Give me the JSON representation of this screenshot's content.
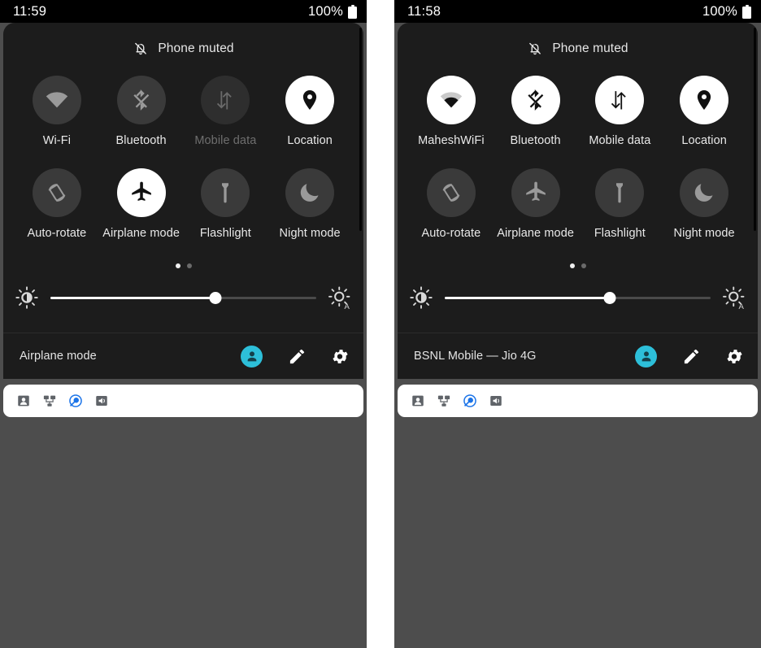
{
  "panels": [
    {
      "name": "left-panel",
      "status_bar": {
        "clock": "11:59",
        "battery_text": "100%",
        "battery_icon": "battery-full-icon"
      },
      "header": {
        "icon": "bell-muted-icon",
        "label": "Phone muted"
      },
      "tiles_row1": [
        {
          "label": "Wi-Fi",
          "icon": "wifi-icon",
          "state": "off"
        },
        {
          "label": "Bluetooth",
          "icon": "bluetooth-icon",
          "state": "off"
        },
        {
          "label": "Mobile data",
          "icon": "mobile-data-icon",
          "state": "disabled"
        },
        {
          "label": "Location",
          "icon": "location-pin-icon",
          "state": "on"
        }
      ],
      "tiles_row2": [
        {
          "label": "Auto-rotate",
          "icon": "auto-rotate-icon",
          "state": "off"
        },
        {
          "label": "Airplane mode",
          "icon": "airplane-icon",
          "state": "on"
        },
        {
          "label": "Flashlight",
          "icon": "flashlight-icon",
          "state": "off"
        },
        {
          "label": "Night mode",
          "icon": "moon-icon",
          "state": "off"
        }
      ],
      "pager": {
        "count": 2,
        "active_index": 0
      },
      "brightness": {
        "low_icon": "brightness-low-icon",
        "auto_icon": "brightness-auto-icon",
        "value_percent": 62
      },
      "footer": {
        "status_text": "Airplane mode",
        "avatar_icon": "user-avatar-icon",
        "edit_icon": "pencil-icon",
        "settings_icon": "gear-icon"
      },
      "notification_icons": [
        {
          "icon": "contact-card-icon",
          "color": "#5f6368"
        },
        {
          "icon": "network-devices-icon",
          "color": "#5f6368"
        },
        {
          "icon": "nearby-share-icon",
          "color": "#1a73e8"
        },
        {
          "icon": "sound-volume-icon",
          "color": "#5f6368"
        }
      ]
    },
    {
      "name": "right-panel",
      "status_bar": {
        "clock": "11:58",
        "battery_text": "100%",
        "battery_icon": "battery-full-icon"
      },
      "header": {
        "icon": "bell-muted-icon",
        "label": "Phone muted"
      },
      "tiles_row1": [
        {
          "label": "MaheshWiFi",
          "icon": "wifi-icon",
          "state": "on"
        },
        {
          "label": "Bluetooth",
          "icon": "bluetooth-icon",
          "state": "on"
        },
        {
          "label": "Mobile data",
          "icon": "mobile-data-icon",
          "state": "on"
        },
        {
          "label": "Location",
          "icon": "location-pin-icon",
          "state": "on"
        }
      ],
      "tiles_row2": [
        {
          "label": "Auto-rotate",
          "icon": "auto-rotate-icon",
          "state": "off"
        },
        {
          "label": "Airplane mode",
          "icon": "airplane-icon",
          "state": "off"
        },
        {
          "label": "Flashlight",
          "icon": "flashlight-icon",
          "state": "off"
        },
        {
          "label": "Night mode",
          "icon": "moon-icon",
          "state": "off"
        }
      ],
      "pager": {
        "count": 2,
        "active_index": 0
      },
      "brightness": {
        "low_icon": "brightness-low-icon",
        "auto_icon": "brightness-auto-icon",
        "value_percent": 62
      },
      "footer": {
        "status_text": "BSNL Mobile — Jio 4G",
        "avatar_icon": "user-avatar-icon",
        "edit_icon": "pencil-icon",
        "settings_icon": "gear-icon"
      },
      "notification_icons": [
        {
          "icon": "contact-card-icon",
          "color": "#5f6368"
        },
        {
          "icon": "network-devices-icon",
          "color": "#5f6368"
        },
        {
          "icon": "nearby-share-icon",
          "color": "#1a73e8"
        },
        {
          "icon": "sound-volume-icon",
          "color": "#5f6368"
        }
      ]
    }
  ],
  "colors": {
    "status_bar_bg": "#000000",
    "shade_bg": "#1c1c1c",
    "tile_off_bg": "#3a3a3a",
    "tile_on_bg": "#ffffff",
    "desktop_bg": "#4d4d4d",
    "accent_avatar": "#2dbfd9",
    "accent_notification": "#1a73e8",
    "page_gap": "#ffffff"
  }
}
